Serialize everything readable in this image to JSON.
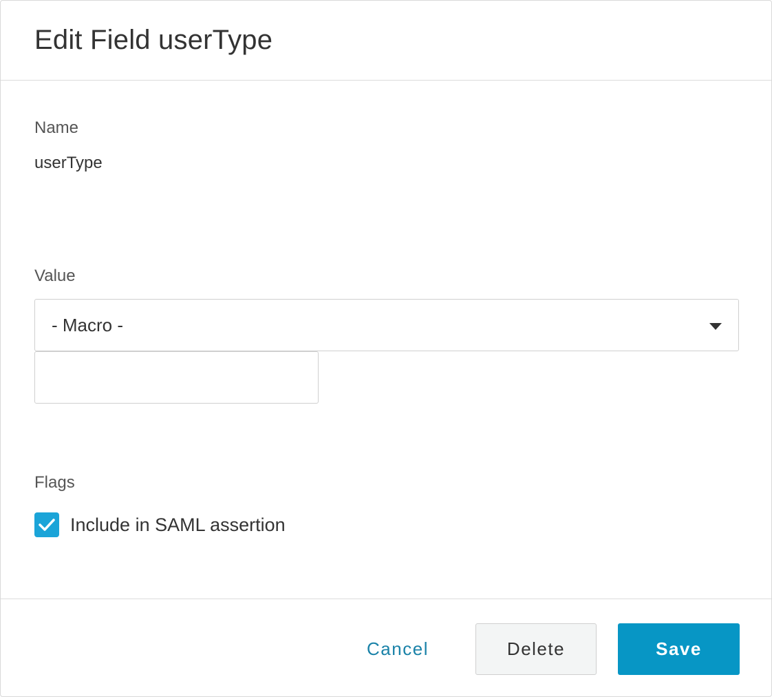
{
  "dialog": {
    "title": "Edit Field userType"
  },
  "form": {
    "name_label": "Name",
    "name_value": "userType",
    "value_label": "Value",
    "value_select": {
      "selected": "- Macro -"
    },
    "macro_input": {
      "value": "",
      "placeholder": ""
    },
    "flags_label": "Flags",
    "flags": [
      {
        "label": "Include in SAML assertion",
        "checked": true
      }
    ]
  },
  "footer": {
    "cancel_label": "Cancel",
    "delete_label": "Delete",
    "save_label": "Save"
  },
  "colors": {
    "accent": "#0796c5",
    "checkbox": "#1ba4d8",
    "link": "#1a82a8"
  },
  "icons": {
    "select_caret": "caret-down-icon",
    "checkbox_mark": "checkmark-icon"
  }
}
